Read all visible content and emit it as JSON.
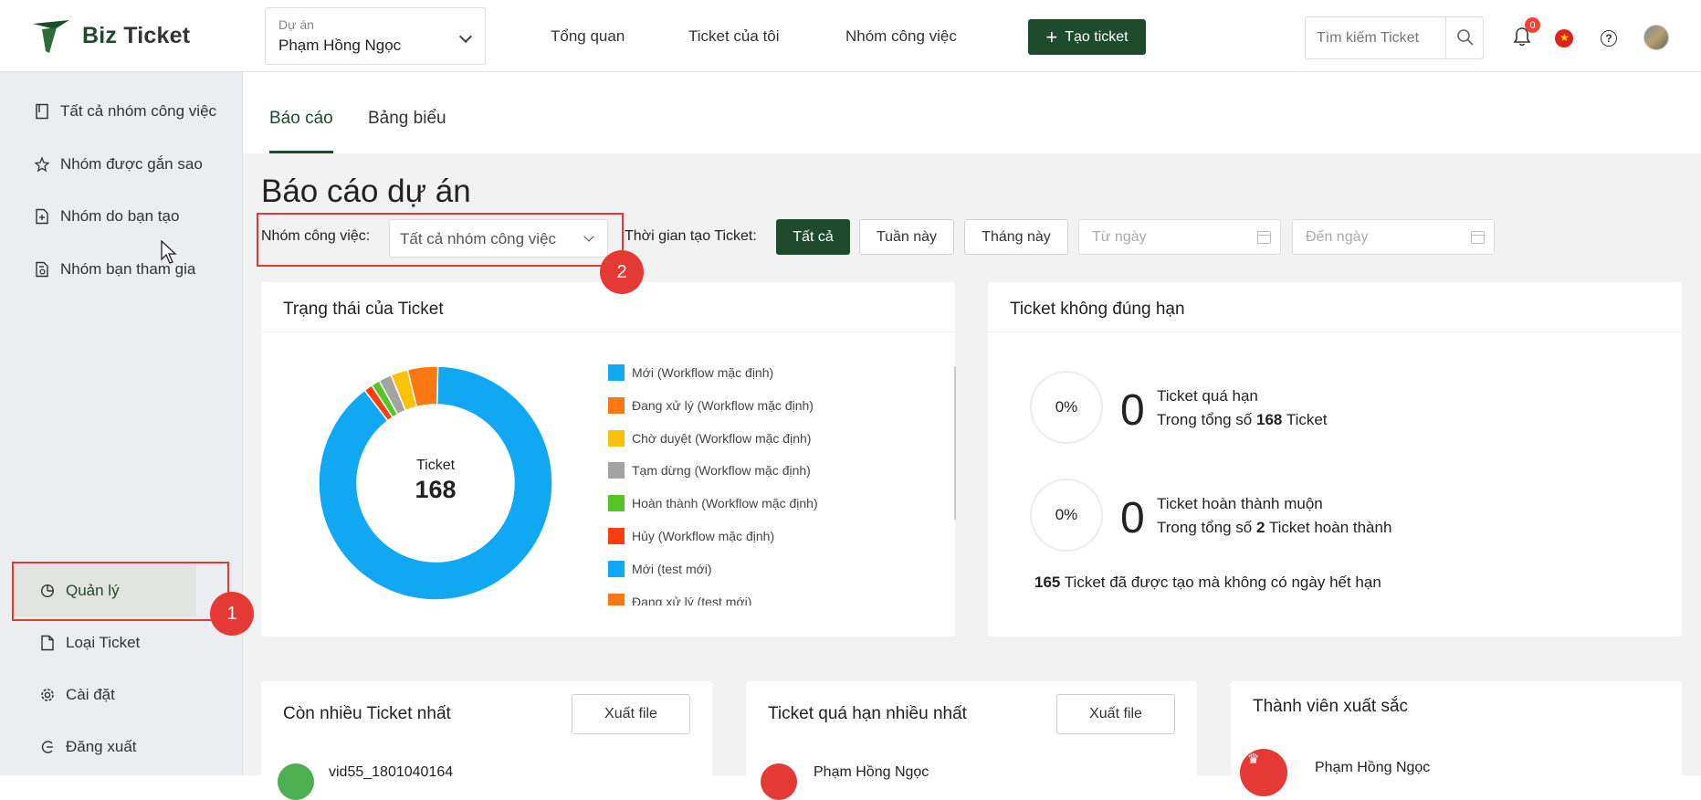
{
  "header": {
    "logo": {
      "part1": "Biz",
      "part2": "Ticket"
    },
    "project": {
      "label": "Dự án",
      "value": "Phạm Hồng Ngọc"
    },
    "nav": [
      "Tổng quan",
      "Ticket của tôi",
      "Nhóm công việc"
    ],
    "create_button": "Tạo ticket",
    "search_placeholder": "Tìm kiếm Ticket",
    "notification_count": "0"
  },
  "sidebar": {
    "top_items": [
      "Tất cả nhóm công việc",
      "Nhóm được gắn sao",
      "Nhóm do bạn tạo",
      "Nhóm bạn tham gia"
    ],
    "bottom_items": [
      "Quản lý",
      "Loại Ticket",
      "Cài đặt",
      "Đăng xuất"
    ],
    "active_item": "Quản lý"
  },
  "tabs": [
    "Báo cáo",
    "Bảng biểu"
  ],
  "page": {
    "title": "Báo cáo dự án",
    "group_filter_label": "Nhóm công việc:",
    "group_filter_value": "Tất cả nhóm công việc",
    "time_filter_label": "Thời gian tạo Ticket:",
    "time_buttons": [
      "Tất cả",
      "Tuần này",
      "Tháng này"
    ],
    "active_time_button": "Tất cả",
    "from_placeholder": "Từ ngày",
    "to_placeholder": "Đến ngày"
  },
  "status_card": {
    "title": "Trạng thái của Ticket",
    "center_label": "Ticket",
    "center_value": "168",
    "legend": [
      {
        "label": "Mới (Workflow mặc định)",
        "color": "#11a8f3"
      },
      {
        "label": "Đang xử lý (Workflow mặc định)",
        "color": "#fa7712"
      },
      {
        "label": "Chờ duyệt (Workflow mặc định)",
        "color": "#fbc10a"
      },
      {
        "label": "Tạm dừng (Workflow mặc định)",
        "color": "#a3a3a3"
      },
      {
        "label": "Hoàn thành (Workflow mặc định)",
        "color": "#55c526"
      },
      {
        "label": "Hủy (Workflow mặc định)",
        "color": "#f93e11"
      },
      {
        "label": "Mới (test mới)",
        "color": "#11a8f3"
      },
      {
        "label": "Đang xử lý (test mới)",
        "color": "#fa7712"
      }
    ]
  },
  "overdue_card": {
    "title": "Ticket không đúng hạn",
    "overdue": {
      "pct": "0%",
      "count": "0",
      "label": "Ticket quá hạn",
      "total_prefix": "Trong tổng số",
      "total": "168",
      "total_suffix": "Ticket"
    },
    "late": {
      "pct": "0%",
      "count": "0",
      "label": "Ticket hoàn thành muộn",
      "total_prefix": "Trong tổng số",
      "total": "2",
      "total_suffix": "Ticket hoàn thành"
    },
    "no_deadline_count": "165",
    "no_deadline_text": "Ticket đã được tạo mà không có ngày hết hạn"
  },
  "bottom_cards": [
    {
      "title": "Còn nhiều Ticket nhất",
      "export": "Xuất file",
      "first_row": "vid55_1801040164"
    },
    {
      "title": "Ticket quá hạn nhiều nhất",
      "export": "Xuất file",
      "first_row": "Phạm Hồng Ngọc"
    },
    {
      "title": "Thành viên xuất sắc",
      "first_row": "Phạm Hồng Ngọc"
    }
  ],
  "annotations": {
    "badge1": "1",
    "badge2": "2"
  },
  "chart_data": {
    "type": "pie",
    "categories": [
      "Mới (Workflow mặc định)",
      "Đang xử lý (Workflow mặc định)",
      "Chờ duyệt (Workflow mặc định)",
      "Tạm dừng (Workflow mặc định)",
      "Hoàn thành (Workflow mặc định)",
      "Hủy (Workflow mặc định)"
    ],
    "values": [
      150,
      7,
      4,
      3,
      2,
      2
    ],
    "colors": [
      "#11a8f3",
      "#fa7712",
      "#fbc10a",
      "#a3a3a3",
      "#55c526",
      "#f93e11"
    ],
    "total": 168
  }
}
